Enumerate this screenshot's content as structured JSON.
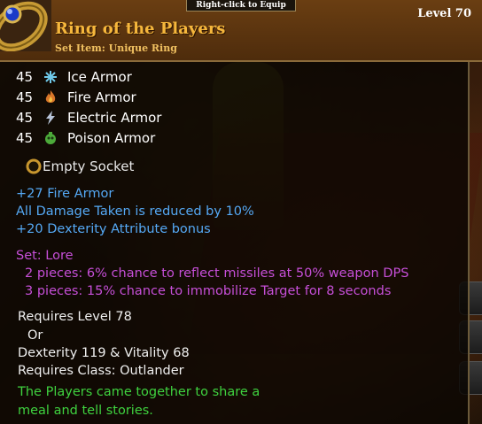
{
  "header": {
    "equip_hint": "Right-click to Equip",
    "level_label": "Level 70",
    "item_name": "Ring of the Players",
    "item_type": "Set Item: Unique Ring"
  },
  "armor": [
    {
      "value": "45",
      "label": "Ice Armor",
      "icon": "snowflake-icon"
    },
    {
      "value": "45",
      "label": "Fire Armor",
      "icon": "flame-icon"
    },
    {
      "value": "45",
      "label": "Electric Armor",
      "icon": "lightning-icon"
    },
    {
      "value": "45",
      "label": "Poison Armor",
      "icon": "poison-icon"
    }
  ],
  "socket": {
    "label": "Empty Socket"
  },
  "bonuses": [
    "+27 Fire Armor",
    "All Damage Taken is reduced by 10%",
    "+20 Dexterity Attribute bonus"
  ],
  "set": {
    "title": "Set: Lore",
    "pieces": [
      "2 pieces: 6% chance to reflect missiles at 50% weapon DPS",
      "3 pieces: 15% chance to immobilize Target for 8 seconds"
    ]
  },
  "requirements": [
    "Requires Level 78",
    "Or",
    "Dexterity 119 & Vitality 68",
    "Requires Class: Outlander"
  ],
  "flavor": [
    "The Players came together to share a",
    "meal and tell stories."
  ],
  "colors": {
    "name": "#f6b73c",
    "bonus": "#55a9f5",
    "set": "#c64fd8",
    "flavor": "#3fd23f"
  }
}
